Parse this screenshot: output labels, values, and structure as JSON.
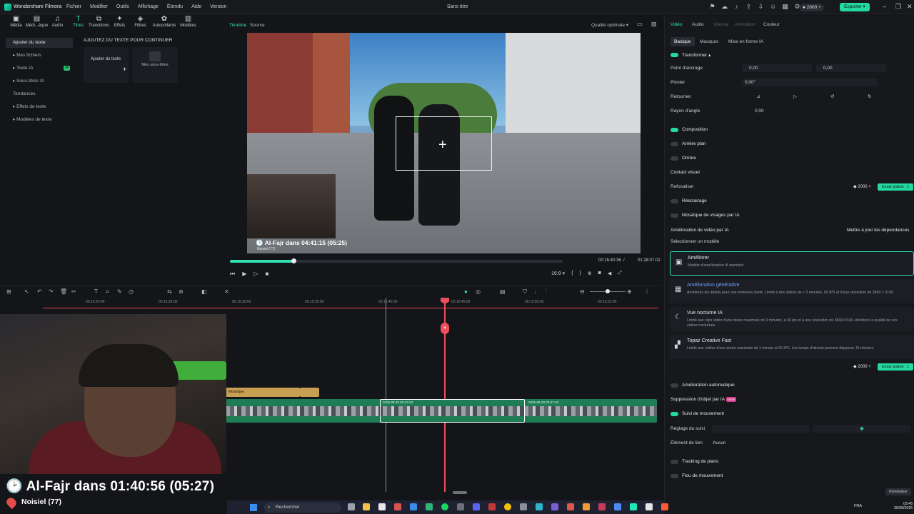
{
  "app": {
    "name": "Wondershare Filmora",
    "document_title": "Sans titre",
    "credits": "2000",
    "export_label": "Exporter"
  },
  "menu": [
    "Fichier",
    "Modifier",
    "Outils",
    "Affichage",
    "Étendu",
    "Aide",
    "Version"
  ],
  "toolbar": [
    {
      "label": "Média",
      "icon": "media-icon"
    },
    {
      "label": "Médi...èque",
      "icon": "library-icon"
    },
    {
      "label": "Audio",
      "icon": "music-icon"
    },
    {
      "label": "Titres",
      "icon": "text-icon",
      "active": true
    },
    {
      "label": "Transitions",
      "icon": "transition-icon"
    },
    {
      "label": "Effets",
      "icon": "effects-icon"
    },
    {
      "label": "Filtres",
      "icon": "filter-icon"
    },
    {
      "label": "Autocollants",
      "icon": "sticker-icon"
    },
    {
      "label": "Modèles",
      "icon": "template-icon"
    }
  ],
  "leftnav": {
    "items": [
      "Ajouter du texte",
      "Mes fichiers",
      "Texte IA",
      "Sous-titres IA",
      "Tendances",
      "Effets de texte",
      "Modèles de texte"
    ],
    "ia_badge": "IA"
  },
  "assets": {
    "header": "AJOUTEZ DU TEXTE POUR CONTINUER",
    "add_text": "Ajouter du texte",
    "my_subtitles": "Mes sous-titres"
  },
  "preview": {
    "tabs": [
      "Timeline",
      "Source"
    ],
    "quality": "Qualité optimale",
    "overlay_title": "Al-Fajr dans 04:41:15 (05:25)",
    "overlay_sub": "Noisiel (77)",
    "current_time": "00:15:40:36",
    "total_time": "01:28:07:02",
    "ratio": "16:9",
    "progress": 0.19
  },
  "rightpanel": {
    "tabs": [
      "Vidéo",
      "Audio",
      "Vitesse",
      "Animation",
      "Couleur"
    ],
    "subtabs": [
      "Basique",
      "Masques",
      "Mise en forme IA"
    ],
    "transformer": "Transformer",
    "anchor_label": "Point d'ancrage",
    "anchor_x": "0,00",
    "anchor_y": "0,00",
    "rotate_label": "Pivoter",
    "rotate_value": "0,00°",
    "flip_label": "Retourner",
    "corner_label": "Rayon d'angle",
    "corner_value": "0,00",
    "composition": "Composition",
    "background": "Arrière plan",
    "shadow": "Ombre",
    "visual_contact": "Contact visuel",
    "refocus": "Refocaliser",
    "refocus_credits": "2000",
    "trial": "Essai gratuit : 1",
    "relight": "Réeclairage",
    "face_mosaic": "Mosaïque de visages par IA",
    "enhance_title": "Amélioration de vidéo par IA",
    "update_deps": "Mettre à jour les dépendances",
    "select_model": "Sélectionner un modèle",
    "models": [
      {
        "title": "Améliorer",
        "desc": "Modèle d'amélioration IA standard",
        "icon": "enhance-icon"
      },
      {
        "title": "Amélioration générative",
        "desc": "Améliorez les détails pour une meilleure clarté. Limité à des vidéos de < 3 minutes, 60 IPS et d'une résolution de 3840 × 2160.",
        "icon": "generative-icon"
      },
      {
        "title": "Vue nocturne IA",
        "desc": "Limité aux clips vidéo d'une durée maximale de 3 minutes, à 60 ips et à une résolution de 3840×2160. Améliore la qualité de vos vidéos nocturnes.",
        "icon": "moon-icon"
      },
      {
        "title": "Topaz Creative Fast",
        "desc": "Limité aux vidéos d'une durée maximale de 1 minute et 60 IPS. Les temps d'attente peuvent dépasser 15 minutes.",
        "icon": "topaz-icon"
      }
    ],
    "model_credits": "2000",
    "auto_enhance": "Amélioration automatique",
    "object_removal": "Suppression d'objet par IA",
    "new_badge": "NEW",
    "motion_tracking": "Suivi de mouvement",
    "tracking_setting": "Réglage du suivi",
    "link_element": "Élément de lien",
    "link_value": "Aucun",
    "plane_tracking": "Tracking de plans",
    "motion_blur": "Flou de mouvement",
    "reset": "Réinitialiser"
  },
  "timeline": {
    "ticks": [
      "00:15:20:00",
      "00:15:25:00",
      "00:15:30:00",
      "00:15:35:00",
      "00:15:40:00",
      "00:15:45:00",
      "00:15:50:00",
      "00:15:55:00"
    ],
    "music_clip": "Mosaïque",
    "clip_label_1": "2025-08-29 00-27-53",
    "clip_label_2": "2025-08-29 00-27-53"
  },
  "webcam": {
    "big_title": "Al-Fajr dans 01:40:56 (05:27)",
    "big_sub": "Noisiel (77)"
  },
  "taskbar": {
    "search": "Rechercher",
    "lang": "FRA",
    "time": "03:46",
    "date": "30/08/2025"
  }
}
